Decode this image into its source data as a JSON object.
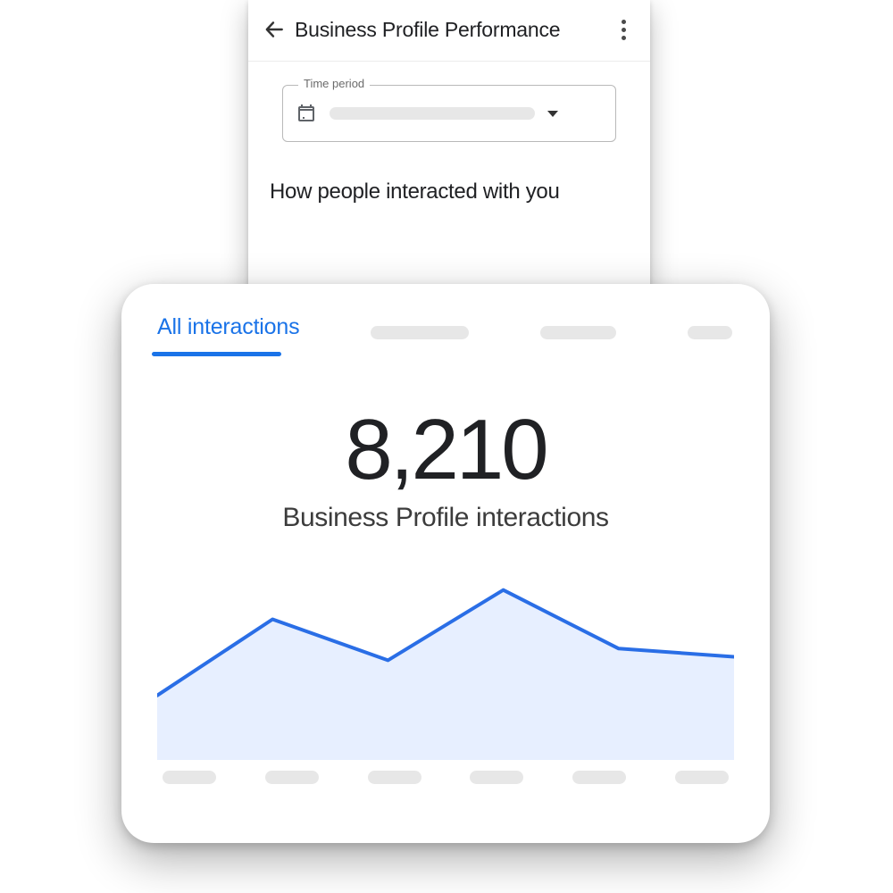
{
  "phone": {
    "title": "Business Profile Performance",
    "time_period_label": "Time period",
    "section_title": "How people interacted with you"
  },
  "card": {
    "tab_active": "All interactions",
    "kpi_value": "8,210",
    "kpi_label": "Business Profile interactions"
  },
  "chart_data": {
    "type": "area",
    "x": [
      0,
      1,
      2,
      3,
      4,
      5
    ],
    "values": [
      55,
      120,
      85,
      145,
      95,
      88
    ],
    "ylim": [
      0,
      160
    ],
    "title": "Business Profile interactions",
    "xlabel": "",
    "ylabel": "",
    "color": "#2a6ee6",
    "fill": "#e7efff"
  }
}
